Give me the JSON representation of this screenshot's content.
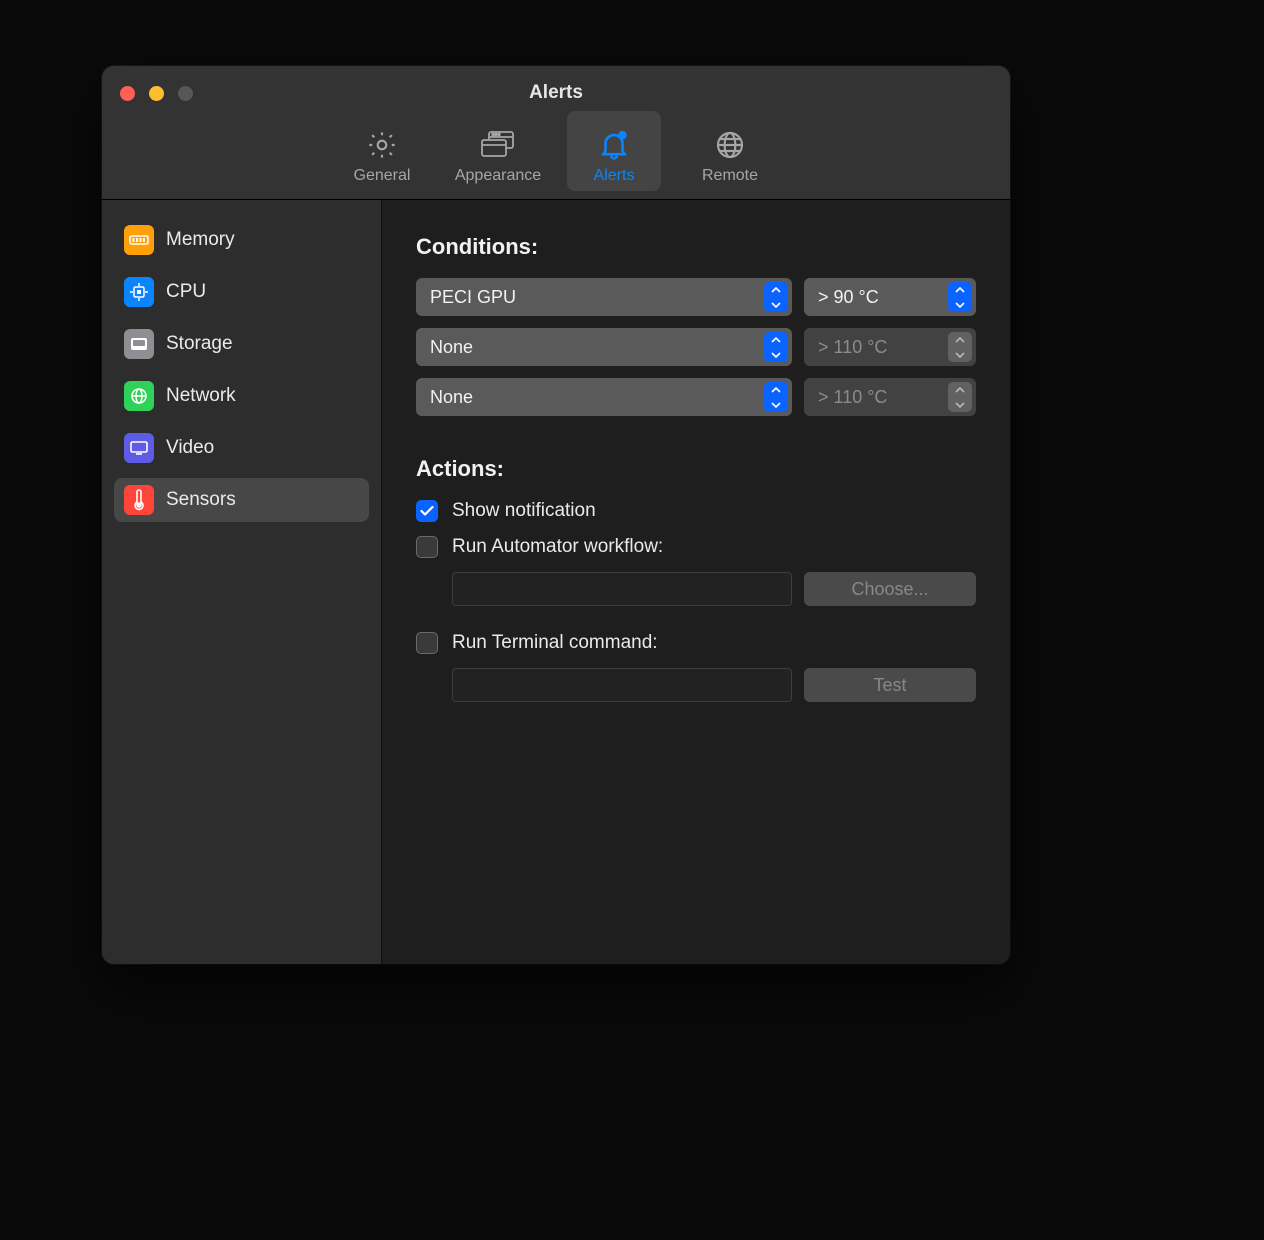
{
  "window": {
    "title": "Alerts"
  },
  "toolbar": {
    "tabs": [
      {
        "label": "General"
      },
      {
        "label": "Appearance"
      },
      {
        "label": "Alerts"
      },
      {
        "label": "Remote"
      }
    ],
    "selected_index": 2
  },
  "sidebar": {
    "items": [
      {
        "label": "Memory"
      },
      {
        "label": "CPU"
      },
      {
        "label": "Storage"
      },
      {
        "label": "Network"
      },
      {
        "label": "Video"
      },
      {
        "label": "Sensors"
      }
    ],
    "selected_index": 5
  },
  "content": {
    "conditions": {
      "title": "Conditions:",
      "rows": [
        {
          "sensor": "PECI GPU",
          "threshold": "> 90 °C",
          "enabled": true
        },
        {
          "sensor": "None",
          "threshold": "> 110 °C",
          "enabled": false
        },
        {
          "sensor": "None",
          "threshold": "> 110 °C",
          "enabled": false
        }
      ]
    },
    "actions": {
      "title": "Actions:",
      "show_notification": {
        "label": "Show notification",
        "checked": true
      },
      "run_automator": {
        "label": "Run Automator workflow:",
        "checked": false,
        "value": "",
        "button": "Choose..."
      },
      "run_terminal": {
        "label": "Run Terminal command:",
        "checked": false,
        "value": "",
        "button": "Test"
      }
    }
  }
}
